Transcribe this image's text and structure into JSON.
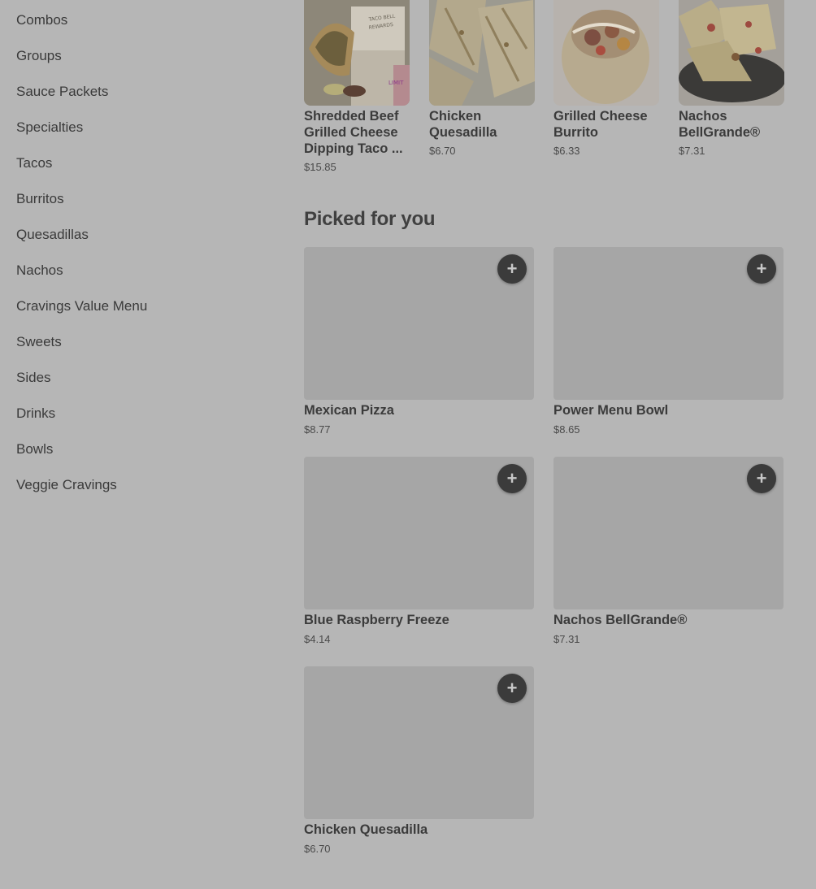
{
  "sidebar": {
    "categories": [
      "Combos",
      "Groups",
      "Sauce Packets",
      "Specialties",
      "Tacos",
      "Burritos",
      "Quesadillas",
      "Nachos",
      "Cravings Value Menu",
      "Sweets",
      "Sides",
      "Drinks",
      "Bowls",
      "Veggie Cravings"
    ]
  },
  "top_row": [
    {
      "name": "Shredded Beef Grilled Cheese Dipping Taco ...",
      "price": "$15.85",
      "image": "taco-meal-box-image"
    },
    {
      "name": "Chicken Quesadilla",
      "price": "$6.70",
      "image": "quesadilla-image"
    },
    {
      "name": "Grilled Cheese Burrito",
      "price": "$6.33",
      "image": "burrito-image"
    },
    {
      "name": "Nachos BellGrande®",
      "price": "$7.31",
      "image": "nachos-image"
    }
  ],
  "picked": {
    "title": "Picked for you",
    "add_symbol": "+",
    "items": [
      {
        "name": "Mexican Pizza",
        "price": "$8.77"
      },
      {
        "name": "Power Menu Bowl",
        "price": "$8.65"
      },
      {
        "name": "Blue Raspberry Freeze",
        "price": "$4.14"
      },
      {
        "name": "Nachos BellGrande®",
        "price": "$7.31"
      },
      {
        "name": "Chicken Quesadilla",
        "price": "$6.70"
      }
    ]
  },
  "colors": {
    "overlay_bg": "#b6b6b6",
    "placeholder": "#a6a6a6",
    "add_button": "#3b3b3b"
  }
}
